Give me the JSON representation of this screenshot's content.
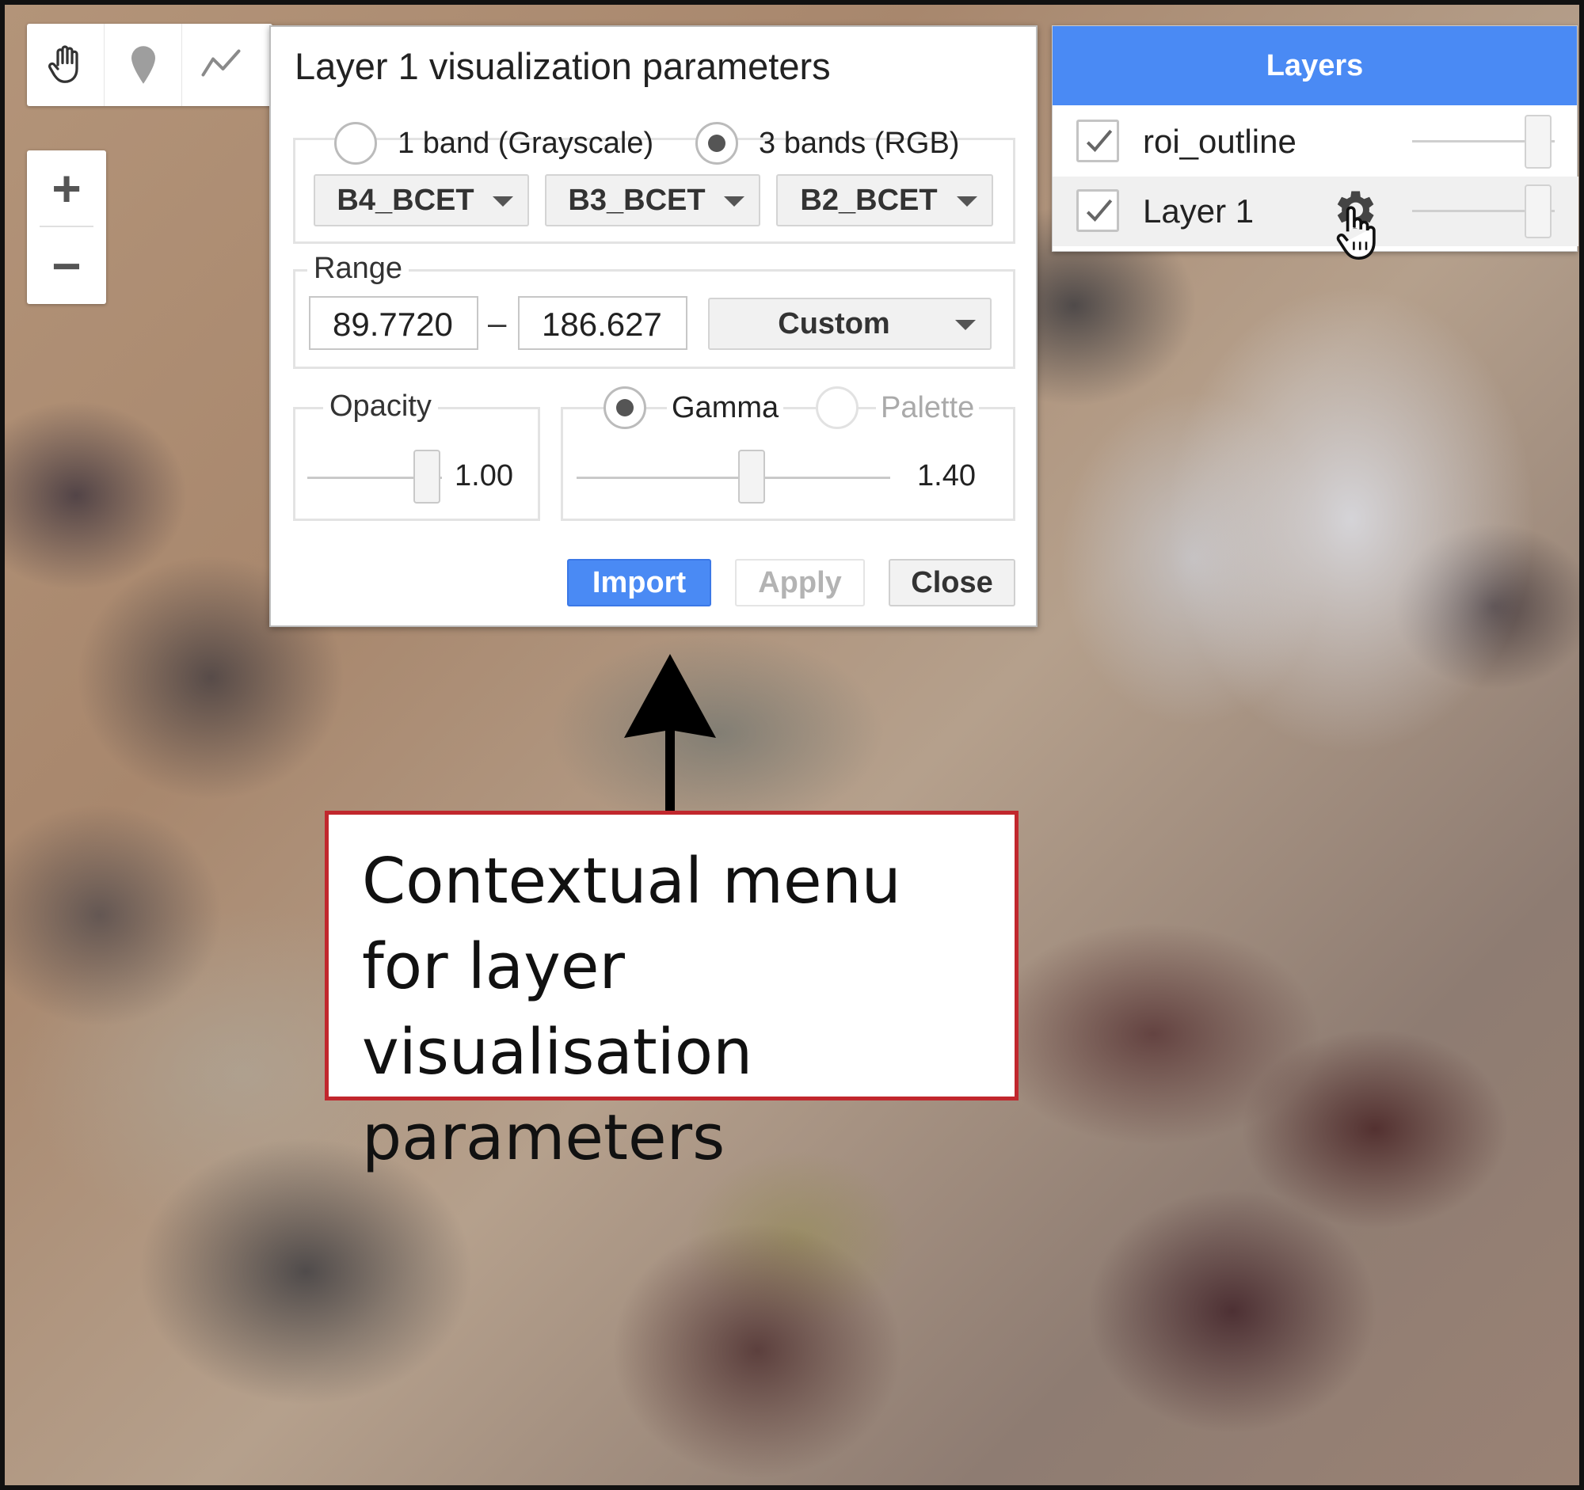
{
  "map_tools": {
    "pan_icon": "hand-icon",
    "marker_icon": "marker-icon",
    "line_icon": "line-icon",
    "zoom_in": "+",
    "zoom_out": "−"
  },
  "vis_dialog": {
    "title": "Layer 1 visualization parameters",
    "band_mode": {
      "option_grayscale": "1 band (Grayscale)",
      "option_rgb": "3 bands (RGB)",
      "selected": "3 bands (RGB)"
    },
    "bands": [
      "B4_BCET",
      "B3_BCET",
      "B2_BCET"
    ],
    "range": {
      "legend": "Range",
      "min": "89.7720",
      "separator": "–",
      "max": "186.627",
      "mode": "Custom"
    },
    "opacity": {
      "legend": "Opacity",
      "value": "1.00",
      "fraction": 1.0
    },
    "color_mode": {
      "option_gamma": "Gamma",
      "option_palette": "Palette",
      "selected": "Gamma",
      "value": "1.40"
    },
    "buttons": {
      "import": "Import",
      "apply": "Apply",
      "close": "Close"
    }
  },
  "layers_panel": {
    "title": "Layers",
    "items": [
      {
        "name": "roi_outline",
        "checked": true,
        "opacity": 1.0
      },
      {
        "name": "Layer 1",
        "checked": true,
        "opacity": 1.0
      }
    ],
    "settings_icon": "gear-icon"
  },
  "annotation": {
    "text": "Contextual menu\nfor layer visualisation\nparameters",
    "border_color": "#c1272d"
  },
  "colors": {
    "accent": "#4a8af4"
  }
}
